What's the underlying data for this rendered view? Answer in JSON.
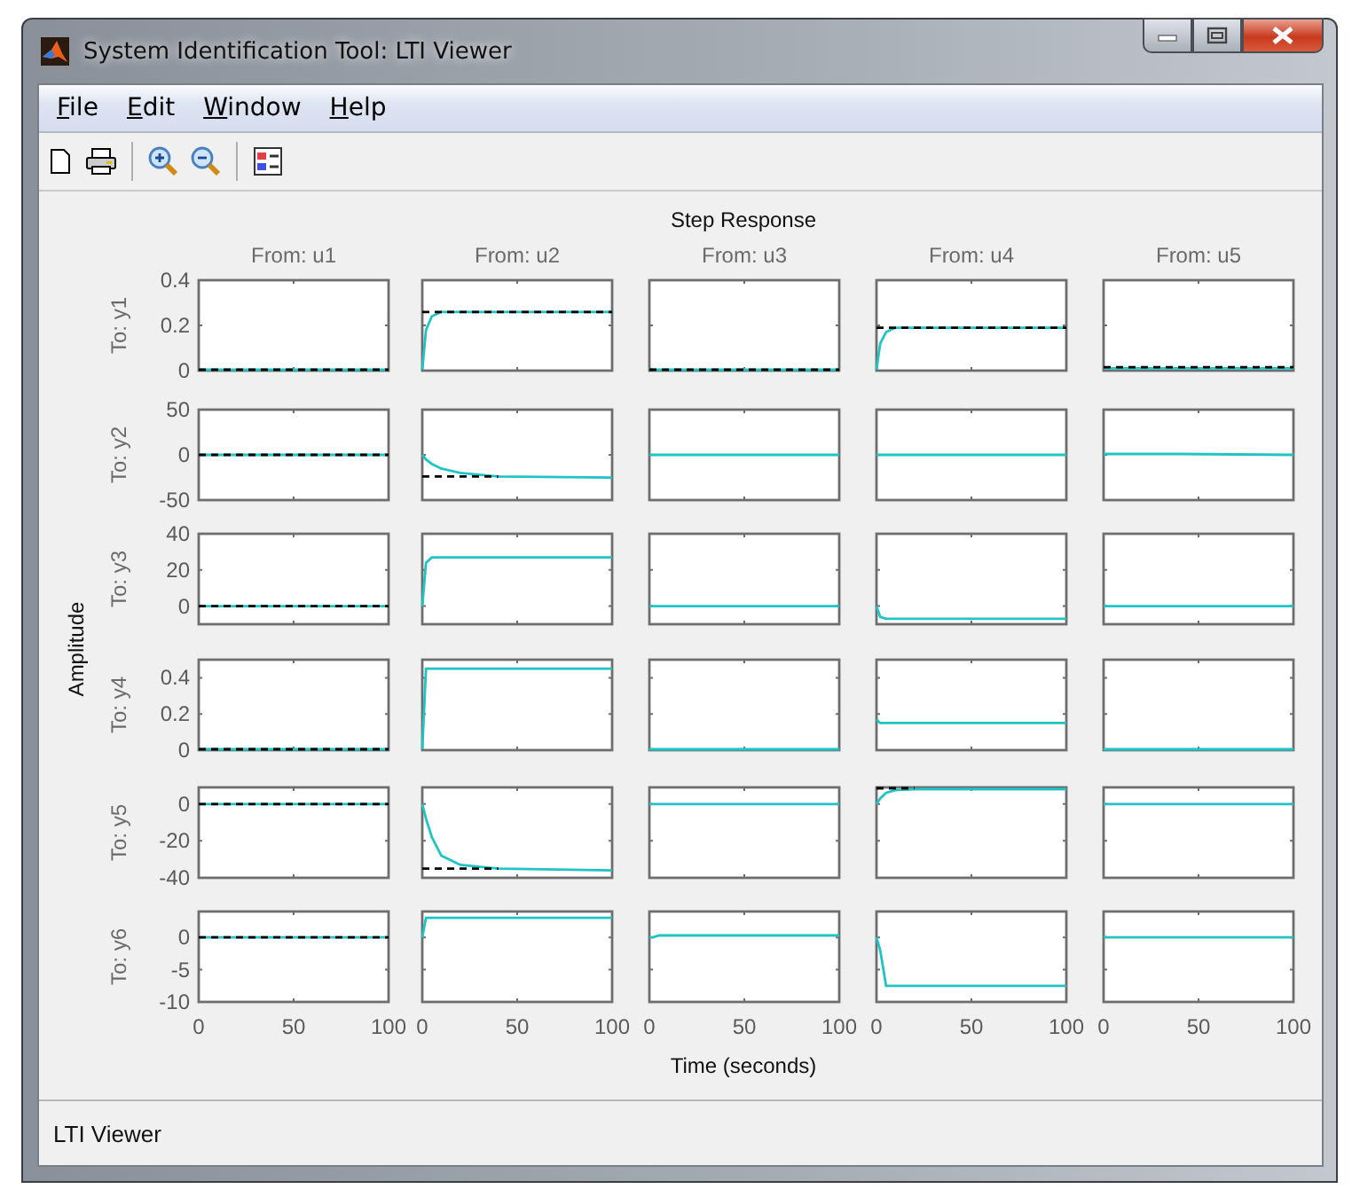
{
  "window": {
    "title": "System Identification Tool: LTI Viewer"
  },
  "menu": [
    {
      "label": "File"
    },
    {
      "label": "Edit"
    },
    {
      "label": "Window"
    },
    {
      "label": "Help"
    }
  ],
  "plot": {
    "title": "Step Response",
    "xlabel": "Time (seconds)",
    "ylabel": "Amplitude",
    "columns": [
      "From: u1",
      "From: u2",
      "From: u3",
      "From: u4",
      "From: u5"
    ],
    "rows": [
      {
        "label": "To: y1",
        "cells": [
          {
            "chart_data": {
              "type": "line",
              "x": [
                0,
                2,
                5,
                10,
                20,
                40,
                100
              ],
              "xlim": [
                0,
                100
              ],
              "ylim": [
                0,
                0.4
              ],
              "yticks": [
                0,
                0.2,
                0.4
              ],
              "series": [
                {
                  "color": "#20c4c4",
                  "line_style": "solid",
                  "values": [
                    0.005,
                    0,
                    0,
                    0,
                    0,
                    0,
                    0
                  ]
                },
                {
                  "color": "#000000",
                  "line_style": "dashed",
                  "values": [
                    0,
                    0,
                    0,
                    0,
                    0,
                    0,
                    0
                  ]
                }
              ]
            }
          },
          {
            "chart_data": {
              "type": "line",
              "x": [
                0,
                2,
                5,
                10,
                20,
                40,
                100
              ],
              "xlim": [
                0,
                100
              ],
              "ylim": [
                0,
                0.4
              ],
              "series": [
                {
                  "color": "#20c4c4",
                  "line_style": "solid",
                  "values": [
                    0,
                    0.18,
                    0.24,
                    0.26,
                    0.26,
                    0.26,
                    0.26
                  ]
                },
                {
                  "color": "#000000",
                  "line_style": "dashed",
                  "values": [
                    0.26,
                    0.26,
                    0.26,
                    0.26,
                    0.26,
                    0.26,
                    0.26
                  ]
                }
              ]
            }
          },
          {
            "chart_data": {
              "type": "line",
              "x": [
                0,
                2,
                5,
                10,
                20,
                40,
                100
              ],
              "xlim": [
                0,
                100
              ],
              "ylim": [
                0,
                0.4
              ],
              "series": [
                {
                  "color": "#20c4c4",
                  "line_style": "solid",
                  "values": [
                    0.01,
                    0.002,
                    0.002,
                    0.002,
                    0.002,
                    0.002,
                    0.002
                  ]
                },
                {
                  "color": "#000000",
                  "line_style": "dashed",
                  "values": [
                    0.002,
                    0.002,
                    0.002,
                    0.002,
                    0.002,
                    0.002,
                    0.002
                  ]
                }
              ]
            }
          },
          {
            "chart_data": {
              "type": "line",
              "x": [
                0,
                2,
                5,
                10,
                20,
                40,
                100
              ],
              "xlim": [
                0,
                100
              ],
              "ylim": [
                0,
                0.4
              ],
              "series": [
                {
                  "color": "#20c4c4",
                  "line_style": "solid",
                  "values": [
                    0,
                    0.12,
                    0.17,
                    0.19,
                    0.19,
                    0.19,
                    0.19
                  ]
                },
                {
                  "color": "#000000",
                  "line_style": "dashed",
                  "values": [
                    0.19,
                    0.19,
                    0.19,
                    0.19,
                    0.19,
                    0.19,
                    0.19
                  ]
                }
              ]
            }
          },
          {
            "chart_data": {
              "type": "line",
              "x": [
                0,
                2,
                5,
                10,
                20,
                40,
                100
              ],
              "xlim": [
                0,
                100
              ],
              "ylim": [
                0,
                0.4
              ],
              "series": [
                {
                  "color": "#20c4c4",
                  "line_style": "solid",
                  "values": [
                    0.01,
                    0.01,
                    0.01,
                    0.01,
                    0.01,
                    0.01,
                    0.01
                  ]
                },
                {
                  "color": "#000000",
                  "line_style": "dashed",
                  "values": [
                    0.015,
                    0.015,
                    0.015,
                    0.015,
                    0.015,
                    0.015,
                    0.015
                  ]
                }
              ]
            }
          }
        ]
      },
      {
        "label": "To: y2",
        "cells": [
          {
            "chart_data": {
              "type": "line",
              "x": [
                0,
                2,
                5,
                10,
                20,
                40,
                100
              ],
              "xlim": [
                0,
                100
              ],
              "ylim": [
                -50,
                50
              ],
              "yticks": [
                -50,
                0,
                50
              ],
              "series": [
                {
                  "color": "#20c4c4",
                  "line_style": "solid",
                  "values": [
                    0,
                    0,
                    0,
                    0,
                    0,
                    0,
                    0
                  ]
                },
                {
                  "color": "#000000",
                  "line_style": "dashed",
                  "values": [
                    0,
                    0,
                    0,
                    0,
                    0,
                    0,
                    0
                  ]
                }
              ]
            }
          },
          {
            "chart_data": {
              "type": "line",
              "x": [
                0,
                2,
                5,
                10,
                20,
                40,
                100
              ],
              "xlim": [
                0,
                100
              ],
              "ylim": [
                -50,
                50
              ],
              "series": [
                {
                  "color": "#20c4c4",
                  "line_style": "solid",
                  "values": [
                    0,
                    -5,
                    -10,
                    -15,
                    -20,
                    -24,
                    -25
                  ]
                },
                {
                  "color": "#000000",
                  "line_style": "dashed",
                  "values": [
                    -24,
                    -24,
                    -24,
                    -24,
                    -24,
                    -24,
                    null
                  ]
                }
              ]
            }
          },
          {
            "chart_data": {
              "type": "line",
              "x": [
                0,
                2,
                5,
                10,
                20,
                40,
                100
              ],
              "xlim": [
                0,
                100
              ],
              "ylim": [
                -50,
                50
              ],
              "series": [
                {
                  "color": "#20c4c4",
                  "line_style": "solid",
                  "values": [
                    0,
                    0,
                    0,
                    0,
                    0,
                    0,
                    0
                  ]
                }
              ]
            }
          },
          {
            "chart_data": {
              "type": "line",
              "x": [
                0,
                2,
                5,
                10,
                20,
                40,
                100
              ],
              "xlim": [
                0,
                100
              ],
              "ylim": [
                -50,
                50
              ],
              "series": [
                {
                  "color": "#20c4c4",
                  "line_style": "solid",
                  "values": [
                    0,
                    0,
                    0,
                    0,
                    0,
                    0,
                    0
                  ]
                }
              ]
            }
          },
          {
            "chart_data": {
              "type": "line",
              "x": [
                0,
                2,
                5,
                10,
                20,
                40,
                100
              ],
              "xlim": [
                0,
                100
              ],
              "ylim": [
                -50,
                50
              ],
              "series": [
                {
                  "color": "#20c4c4",
                  "line_style": "solid",
                  "values": [
                    1,
                    1,
                    1,
                    1,
                    1,
                    1,
                    0
                  ]
                }
              ]
            }
          }
        ]
      },
      {
        "label": "To: y3",
        "cells": [
          {
            "chart_data": {
              "type": "line",
              "x": [
                0,
                2,
                5,
                10,
                20,
                40,
                100
              ],
              "xlim": [
                0,
                100
              ],
              "ylim": [
                -10,
                40
              ],
              "yticks": [
                0,
                20,
                40
              ],
              "series": [
                {
                  "color": "#20c4c4",
                  "line_style": "solid",
                  "values": [
                    0,
                    0,
                    0,
                    0,
                    0,
                    0,
                    0
                  ]
                },
                {
                  "color": "#000000",
                  "line_style": "dashed",
                  "values": [
                    0,
                    0,
                    0,
                    0,
                    0,
                    0,
                    0
                  ]
                }
              ]
            }
          },
          {
            "chart_data": {
              "type": "line",
              "x": [
                0,
                2,
                5,
                10,
                20,
                40,
                100
              ],
              "xlim": [
                0,
                100
              ],
              "ylim": [
                -10,
                40
              ],
              "series": [
                {
                  "color": "#20c4c4",
                  "line_style": "solid",
                  "values": [
                    0,
                    24,
                    27,
                    27,
                    27,
                    27,
                    27
                  ]
                }
              ]
            }
          },
          {
            "chart_data": {
              "type": "line",
              "x": [
                0,
                2,
                5,
                10,
                20,
                40,
                100
              ],
              "xlim": [
                0,
                100
              ],
              "ylim": [
                -10,
                40
              ],
              "series": [
                {
                  "color": "#20c4c4",
                  "line_style": "solid",
                  "values": [
                    0,
                    0,
                    0,
                    0,
                    0,
                    0,
                    0
                  ]
                }
              ]
            }
          },
          {
            "chart_data": {
              "type": "line",
              "x": [
                0,
                2,
                5,
                10,
                20,
                40,
                100
              ],
              "xlim": [
                0,
                100
              ],
              "ylim": [
                -10,
                40
              ],
              "series": [
                {
                  "color": "#20c4c4",
                  "line_style": "solid",
                  "values": [
                    0,
                    -6,
                    -7,
                    -7,
                    -7,
                    -7,
                    -7
                  ]
                }
              ]
            }
          },
          {
            "chart_data": {
              "type": "line",
              "x": [
                0,
                2,
                5,
                10,
                20,
                40,
                100
              ],
              "xlim": [
                0,
                100
              ],
              "ylim": [
                -10,
                40
              ],
              "series": [
                {
                  "color": "#20c4c4",
                  "line_style": "solid",
                  "values": [
                    0,
                    0,
                    0,
                    0,
                    0,
                    0,
                    0
                  ]
                }
              ]
            }
          }
        ]
      },
      {
        "label": "To: y4",
        "cells": [
          {
            "chart_data": {
              "type": "line",
              "x": [
                0,
                2,
                5,
                10,
                20,
                40,
                100
              ],
              "xlim": [
                0,
                100
              ],
              "ylim": [
                0,
                0.5
              ],
              "yticks": [
                0,
                0.2,
                0.4
              ],
              "series": [
                {
                  "color": "#20c4c4",
                  "line_style": "solid",
                  "values": [
                    0.003,
                    0.003,
                    0.003,
                    0.003,
                    0.003,
                    0.003,
                    0.003
                  ]
                },
                {
                  "color": "#000000",
                  "line_style": "dashed",
                  "values": [
                    0,
                    0,
                    0,
                    0,
                    0,
                    0,
                    0
                  ]
                }
              ]
            }
          },
          {
            "chart_data": {
              "type": "line",
              "x": [
                0,
                2,
                5,
                10,
                20,
                40,
                100
              ],
              "xlim": [
                0,
                100
              ],
              "ylim": [
                0,
                0.5
              ],
              "series": [
                {
                  "color": "#20c4c4",
                  "line_style": "solid",
                  "values": [
                    0,
                    0.45,
                    0.45,
                    0.45,
                    0.45,
                    0.45,
                    0.45
                  ]
                }
              ]
            }
          },
          {
            "chart_data": {
              "type": "line",
              "x": [
                0,
                2,
                5,
                10,
                20,
                40,
                100
              ],
              "xlim": [
                0,
                100
              ],
              "ylim": [
                0,
                0.5
              ],
              "series": [
                {
                  "color": "#20c4c4",
                  "line_style": "solid",
                  "values": [
                    0.003,
                    0.003,
                    0.003,
                    0.003,
                    0.003,
                    0.003,
                    0.003
                  ]
                }
              ]
            }
          },
          {
            "chart_data": {
              "type": "line",
              "x": [
                0,
                2,
                5,
                10,
                20,
                40,
                100
              ],
              "xlim": [
                0,
                100
              ],
              "ylim": [
                0,
                0.5
              ],
              "series": [
                {
                  "color": "#20c4c4",
                  "line_style": "solid",
                  "values": [
                    0.17,
                    0.15,
                    0.15,
                    0.15,
                    0.15,
                    0.15,
                    0.15
                  ]
                }
              ]
            }
          },
          {
            "chart_data": {
              "type": "line",
              "x": [
                0,
                2,
                5,
                10,
                20,
                40,
                100
              ],
              "xlim": [
                0,
                100
              ],
              "ylim": [
                0,
                0.5
              ],
              "series": [
                {
                  "color": "#20c4c4",
                  "line_style": "solid",
                  "values": [
                    0.003,
                    0.003,
                    0.003,
                    0.003,
                    0.003,
                    0.003,
                    0.003
                  ]
                }
              ]
            }
          }
        ]
      },
      {
        "label": "To: y5",
        "cells": [
          {
            "chart_data": {
              "type": "line",
              "x": [
                0,
                2,
                5,
                10,
                20,
                40,
                100
              ],
              "xlim": [
                0,
                100
              ],
              "ylim": [
                -40,
                9
              ],
              "yticks": [
                -40,
                -20,
                0
              ],
              "series": [
                {
                  "color": "#20c4c4",
                  "line_style": "solid",
                  "values": [
                    0,
                    0,
                    0,
                    0,
                    0,
                    0,
                    0
                  ]
                },
                {
                  "color": "#000000",
                  "line_style": "dashed",
                  "values": [
                    0,
                    0,
                    0,
                    0,
                    0,
                    0,
                    0
                  ]
                }
              ]
            }
          },
          {
            "chart_data": {
              "type": "line",
              "x": [
                0,
                2,
                5,
                10,
                20,
                40,
                100
              ],
              "xlim": [
                0,
                100
              ],
              "ylim": [
                -40,
                9
              ],
              "series": [
                {
                  "color": "#20c4c4",
                  "line_style": "solid",
                  "values": [
                    0,
                    -8,
                    -18,
                    -28,
                    -33,
                    -35,
                    -36
                  ]
                },
                {
                  "color": "#000000",
                  "line_style": "dashed",
                  "values": [
                    -35,
                    -35,
                    -35,
                    -35,
                    -35,
                    -35,
                    null
                  ]
                }
              ]
            }
          },
          {
            "chart_data": {
              "type": "line",
              "x": [
                0,
                2,
                5,
                10,
                20,
                40,
                100
              ],
              "xlim": [
                0,
                100
              ],
              "ylim": [
                -40,
                9
              ],
              "series": [
                {
                  "color": "#20c4c4",
                  "line_style": "solid",
                  "values": [
                    0,
                    0,
                    0,
                    0,
                    0,
                    0,
                    0
                  ]
                }
              ]
            }
          },
          {
            "chart_data": {
              "type": "line",
              "x": [
                0,
                2,
                5,
                10,
                20,
                40,
                100
              ],
              "xlim": [
                0,
                100
              ],
              "ylim": [
                -40,
                9
              ],
              "series": [
                {
                  "color": "#20c4c4",
                  "line_style": "solid",
                  "values": [
                    0,
                    3,
                    6,
                    7.5,
                    8,
                    8,
                    8
                  ]
                },
                {
                  "color": "#000000",
                  "line_style": "dashed",
                  "values": [
                    8.5,
                    8.5,
                    8.5,
                    8.5,
                    8.5,
                    null,
                    null
                  ]
                }
              ]
            }
          },
          {
            "chart_data": {
              "type": "line",
              "x": [
                0,
                2,
                5,
                10,
                20,
                40,
                100
              ],
              "xlim": [
                0,
                100
              ],
              "ylim": [
                -40,
                9
              ],
              "series": [
                {
                  "color": "#20c4c4",
                  "line_style": "solid",
                  "values": [
                    0,
                    0,
                    0,
                    0,
                    0,
                    0,
                    0
                  ]
                }
              ]
            }
          }
        ]
      },
      {
        "label": "To: y6",
        "cells": [
          {
            "chart_data": {
              "type": "line",
              "x": [
                0,
                2,
                5,
                10,
                20,
                40,
                100
              ],
              "xlim": [
                0,
                100
              ],
              "ylim": [
                -10,
                4
              ],
              "xticks": [
                0,
                50,
                100
              ],
              "yticks": [
                -10,
                -5,
                0
              ],
              "series": [
                {
                  "color": "#20c4c4",
                  "line_style": "solid",
                  "values": [
                    0,
                    0,
                    0,
                    0,
                    0,
                    0,
                    0
                  ]
                },
                {
                  "color": "#000000",
                  "line_style": "dashed",
                  "values": [
                    0,
                    0,
                    0,
                    0,
                    0,
                    0,
                    0
                  ]
                }
              ]
            }
          },
          {
            "chart_data": {
              "type": "line",
              "x": [
                0,
                2,
                5,
                10,
                20,
                40,
                100
              ],
              "xlim": [
                0,
                100
              ],
              "ylim": [
                -10,
                4
              ],
              "xticks": [
                0,
                50,
                100
              ],
              "series": [
                {
                  "color": "#20c4c4",
                  "line_style": "solid",
                  "values": [
                    0,
                    3,
                    3,
                    3,
                    3,
                    3,
                    3
                  ]
                }
              ]
            }
          },
          {
            "chart_data": {
              "type": "line",
              "x": [
                0,
                2,
                5,
                10,
                20,
                40,
                100
              ],
              "xlim": [
                0,
                100
              ],
              "ylim": [
                -10,
                4
              ],
              "xticks": [
                0,
                50,
                100
              ],
              "series": [
                {
                  "color": "#20c4c4",
                  "line_style": "solid",
                  "values": [
                    0,
                    0,
                    0.3,
                    0.3,
                    0.3,
                    0.3,
                    0.3
                  ]
                }
              ]
            }
          },
          {
            "chart_data": {
              "type": "line",
              "x": [
                0,
                2,
                5,
                10,
                20,
                40,
                100
              ],
              "xlim": [
                0,
                100
              ],
              "ylim": [
                -10,
                4
              ],
              "xticks": [
                0,
                50,
                100
              ],
              "series": [
                {
                  "color": "#20c4c4",
                  "line_style": "solid",
                  "values": [
                    0,
                    -2,
                    -7.5,
                    -7.5,
                    -7.5,
                    -7.5,
                    -7.5
                  ]
                }
              ]
            }
          },
          {
            "chart_data": {
              "type": "line",
              "x": [
                0,
                2,
                5,
                10,
                20,
                40,
                100
              ],
              "xlim": [
                0,
                100
              ],
              "ylim": [
                -10,
                4
              ],
              "xticks": [
                0,
                50,
                100
              ],
              "series": [
                {
                  "color": "#20c4c4",
                  "line_style": "solid",
                  "values": [
                    0.1,
                    0,
                    0,
                    0,
                    0,
                    0,
                    0
                  ]
                }
              ]
            }
          }
        ]
      }
    ]
  },
  "status_bar": "LTI Viewer"
}
